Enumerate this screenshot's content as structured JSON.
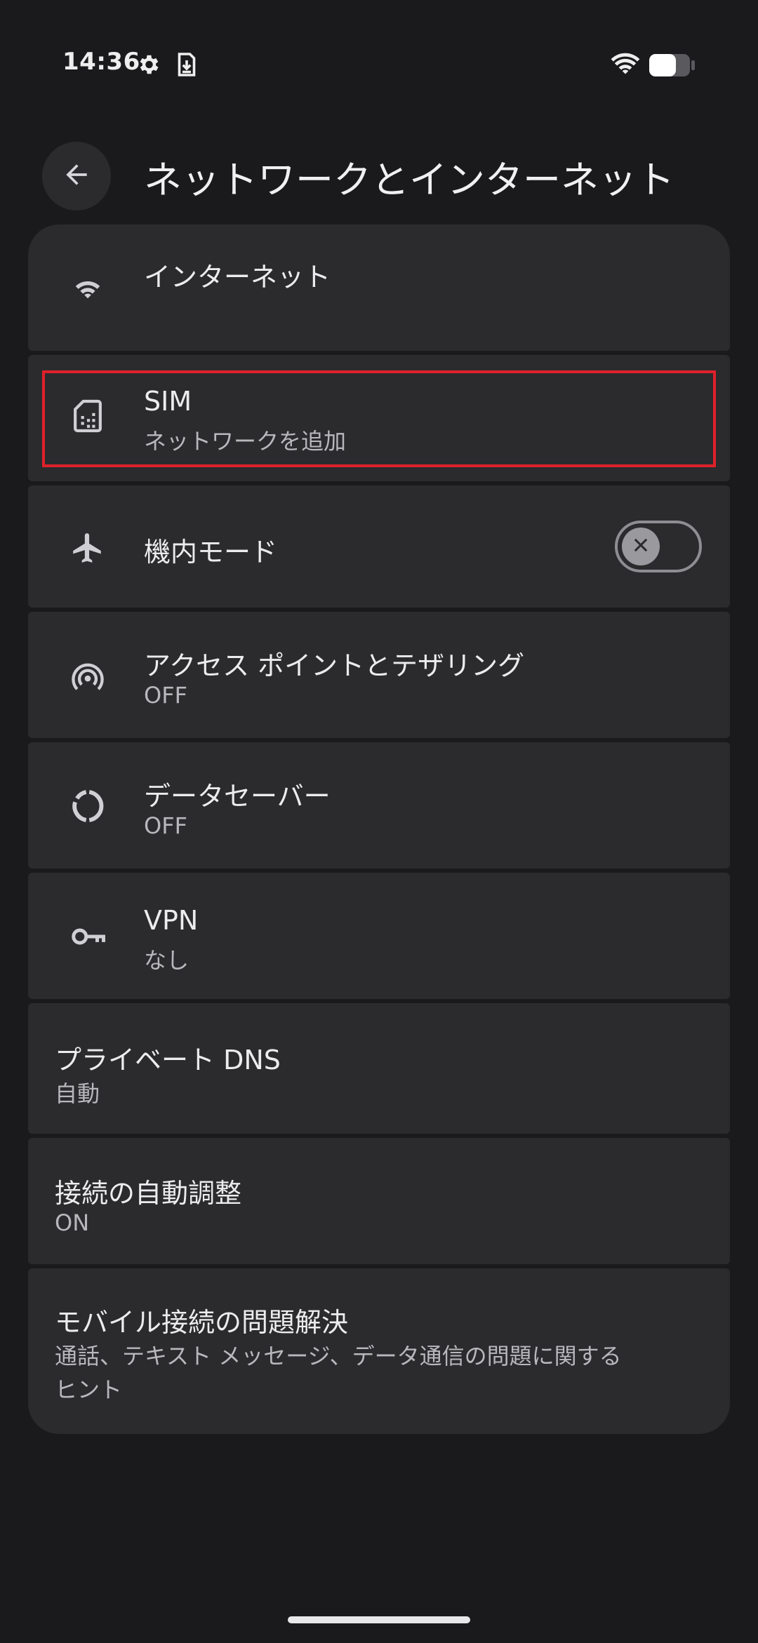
{
  "status_bar": {
    "time": "14:36",
    "icons": [
      "gear-icon",
      "download-icon",
      "wifi-icon",
      "battery-icon"
    ]
  },
  "header": {
    "title": "ネットワークとインターネット",
    "back_icon": "arrow-back-icon"
  },
  "items": [
    {
      "title": "インターネット",
      "icon": "wifi-icon"
    },
    {
      "title": "SIM",
      "subtitle": "ネットワークを追加",
      "icon": "sim-card-icon",
      "highlighted": true
    },
    {
      "title": "機内モード",
      "icon": "airplane-icon",
      "toggle": {
        "on": false,
        "icon": "close-icon"
      }
    },
    {
      "title": "アクセス ポイントとテザリング",
      "subtitle": "OFF",
      "icon": "hotspot-icon"
    },
    {
      "title": "データセーバー",
      "subtitle": "OFF",
      "icon": "data-saver-icon"
    },
    {
      "title": "VPN",
      "subtitle": "なし",
      "icon": "vpn-key-icon"
    },
    {
      "title": "プライベート DNS",
      "subtitle": "自動"
    },
    {
      "title": "接続の自動調整",
      "subtitle": "ON"
    },
    {
      "title": "モバイル接続の問題解決",
      "subtitle_line1": "通話、テキスト メッセージ、データ通信の問題に関する",
      "subtitle_line2": "ヒント"
    }
  ],
  "colors": {
    "background": "#1a1a1c",
    "card": "#2b2b2e",
    "highlight_border": "#e0202a",
    "text_primary": "#ececee",
    "text_secondary": "#b8b8bc"
  }
}
